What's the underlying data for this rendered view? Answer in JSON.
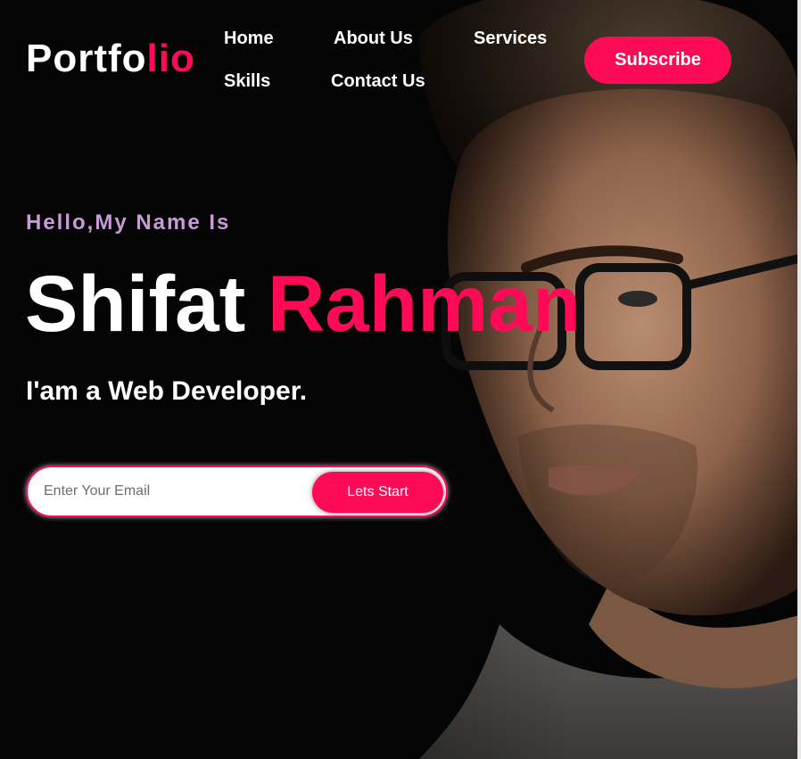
{
  "logo": {
    "part1": "Portfo",
    "part2": "lio"
  },
  "nav": {
    "home": "Home",
    "about": "About Us",
    "services": "Services",
    "skills": "Skills",
    "contact": "Contact Us"
  },
  "subscribe_label": "Subscribe",
  "hero": {
    "greeting": "Hello,My Name Is",
    "first_name": "Shifat",
    "last_name": "Rahman",
    "role": "I'am a Web Developer."
  },
  "form": {
    "email_placeholder": "Enter Your Email",
    "submit_label": "Lets Start"
  },
  "colors": {
    "accent": "#ff0a57",
    "greeting": "#c89ad6",
    "background": "#050505"
  }
}
